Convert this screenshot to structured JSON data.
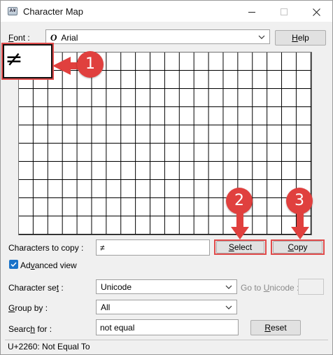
{
  "window": {
    "title": "Character Map",
    "icon": "character-map-app-icon",
    "controls": {
      "minimize": "minimize-icon",
      "maximize": "maximize-icon",
      "close": "close-icon"
    }
  },
  "font_row": {
    "label_prefix": "F",
    "label_rest": "ont :",
    "selected_font": "Arial",
    "font_type_glyph": "O",
    "help_prefix": "H",
    "help_rest": "elp"
  },
  "grid": {
    "selected_char": "≠",
    "columns": 20,
    "rows": 10
  },
  "copy_row": {
    "label": "Characters to copy :",
    "value": "≠",
    "select_prefix": "S",
    "select_rest": "elect",
    "copy_prefix": "C",
    "copy_rest": "opy"
  },
  "advanced": {
    "checked": true,
    "label_prefix": "Ad",
    "label_u": "v",
    "label_rest": "anced view"
  },
  "character_set": {
    "label_prefix": "Character se",
    "label_u": "t",
    "label_rest": " :",
    "value": "Unicode",
    "goto_label_prefix": "Go to ",
    "goto_label_u": "U",
    "goto_label_rest": "nicode :",
    "goto_value": ""
  },
  "group_by": {
    "label_prefix": "G",
    "label_rest": "roup by :",
    "value": "All"
  },
  "search": {
    "label_prefix": "Searc",
    "label_u": "h",
    "label_rest": " for :",
    "value": "not equal",
    "reset_prefix": "R",
    "reset_rest": "eset"
  },
  "status": {
    "text": "U+2260: Not Equal To"
  },
  "callouts": [
    "1",
    "2",
    "3"
  ],
  "colors": {
    "callout": "#e0403e",
    "highlight_border": "#e04b4b",
    "checkbox": "#1a73c9"
  }
}
